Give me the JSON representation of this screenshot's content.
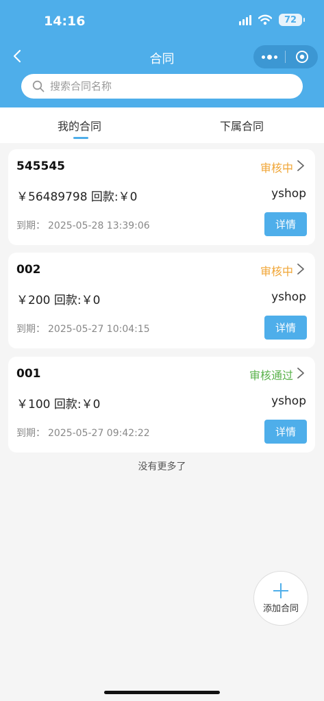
{
  "status_bar": {
    "time": "14:16",
    "battery": "72"
  },
  "nav": {
    "title": "合同"
  },
  "search": {
    "placeholder": "搜索合同名称"
  },
  "tabs": [
    {
      "label": "我的合同"
    },
    {
      "label": "下属合同"
    }
  ],
  "contracts": [
    {
      "name": "545545",
      "status": "审核中",
      "amount": "￥56489798 回款:￥0",
      "owner": "yshop",
      "due_label": "到期：",
      "due_value": "2025-05-28 13:39:06",
      "detail_label": "详情"
    },
    {
      "name": "002",
      "status": "审核中",
      "amount": "￥200 回款:￥0",
      "owner": "yshop",
      "due_label": "到期：",
      "due_value": "2025-05-27 10:04:15",
      "detail_label": "详情"
    },
    {
      "name": "001",
      "status": "审核通过",
      "amount": "￥100 回款:￥0",
      "owner": "yshop",
      "due_label": "到期：",
      "due_value": "2025-05-27 09:42:22",
      "detail_label": "详情"
    }
  ],
  "list_footer": "没有更多了",
  "fab": {
    "label": "添加合同"
  },
  "colors": {
    "primary": "#4eaeea",
    "pending": "#f0a535",
    "approved": "#5ab24b"
  }
}
